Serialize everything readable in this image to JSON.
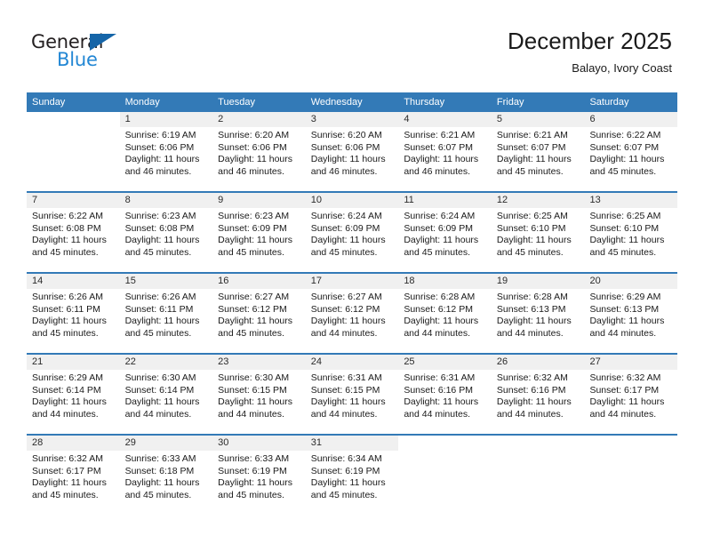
{
  "brand": {
    "name_part1": "General",
    "name_part2": "Blue",
    "triangle_color": "#1565a8",
    "blue_color": "#2387d4"
  },
  "header": {
    "title": "December 2025",
    "subtitle": "Balayo, Ivory Coast"
  },
  "theme": {
    "header_blue": "#337ab7",
    "day_band_gray": "#f0f0f0",
    "text_color": "#1a1a1a"
  },
  "weekdays": [
    "Sunday",
    "Monday",
    "Tuesday",
    "Wednesday",
    "Thursday",
    "Friday",
    "Saturday"
  ],
  "weeks": [
    [
      {
        "day": "",
        "empty": true,
        "sunrise": "",
        "sunset": "",
        "daylight_line1": "",
        "daylight_line2": ""
      },
      {
        "day": "1",
        "sunrise": "Sunrise: 6:19 AM",
        "sunset": "Sunset: 6:06 PM",
        "daylight_line1": "Daylight: 11 hours",
        "daylight_line2": "and 46 minutes."
      },
      {
        "day": "2",
        "sunrise": "Sunrise: 6:20 AM",
        "sunset": "Sunset: 6:06 PM",
        "daylight_line1": "Daylight: 11 hours",
        "daylight_line2": "and 46 minutes."
      },
      {
        "day": "3",
        "sunrise": "Sunrise: 6:20 AM",
        "sunset": "Sunset: 6:06 PM",
        "daylight_line1": "Daylight: 11 hours",
        "daylight_line2": "and 46 minutes."
      },
      {
        "day": "4",
        "sunrise": "Sunrise: 6:21 AM",
        "sunset": "Sunset: 6:07 PM",
        "daylight_line1": "Daylight: 11 hours",
        "daylight_line2": "and 46 minutes."
      },
      {
        "day": "5",
        "sunrise": "Sunrise: 6:21 AM",
        "sunset": "Sunset: 6:07 PM",
        "daylight_line1": "Daylight: 11 hours",
        "daylight_line2": "and 45 minutes."
      },
      {
        "day": "6",
        "sunrise": "Sunrise: 6:22 AM",
        "sunset": "Sunset: 6:07 PM",
        "daylight_line1": "Daylight: 11 hours",
        "daylight_line2": "and 45 minutes."
      }
    ],
    [
      {
        "day": "7",
        "sunrise": "Sunrise: 6:22 AM",
        "sunset": "Sunset: 6:08 PM",
        "daylight_line1": "Daylight: 11 hours",
        "daylight_line2": "and 45 minutes."
      },
      {
        "day": "8",
        "sunrise": "Sunrise: 6:23 AM",
        "sunset": "Sunset: 6:08 PM",
        "daylight_line1": "Daylight: 11 hours",
        "daylight_line2": "and 45 minutes."
      },
      {
        "day": "9",
        "sunrise": "Sunrise: 6:23 AM",
        "sunset": "Sunset: 6:09 PM",
        "daylight_line1": "Daylight: 11 hours",
        "daylight_line2": "and 45 minutes."
      },
      {
        "day": "10",
        "sunrise": "Sunrise: 6:24 AM",
        "sunset": "Sunset: 6:09 PM",
        "daylight_line1": "Daylight: 11 hours",
        "daylight_line2": "and 45 minutes."
      },
      {
        "day": "11",
        "sunrise": "Sunrise: 6:24 AM",
        "sunset": "Sunset: 6:09 PM",
        "daylight_line1": "Daylight: 11 hours",
        "daylight_line2": "and 45 minutes."
      },
      {
        "day": "12",
        "sunrise": "Sunrise: 6:25 AM",
        "sunset": "Sunset: 6:10 PM",
        "daylight_line1": "Daylight: 11 hours",
        "daylight_line2": "and 45 minutes."
      },
      {
        "day": "13",
        "sunrise": "Sunrise: 6:25 AM",
        "sunset": "Sunset: 6:10 PM",
        "daylight_line1": "Daylight: 11 hours",
        "daylight_line2": "and 45 minutes."
      }
    ],
    [
      {
        "day": "14",
        "sunrise": "Sunrise: 6:26 AM",
        "sunset": "Sunset: 6:11 PM",
        "daylight_line1": "Daylight: 11 hours",
        "daylight_line2": "and 45 minutes."
      },
      {
        "day": "15",
        "sunrise": "Sunrise: 6:26 AM",
        "sunset": "Sunset: 6:11 PM",
        "daylight_line1": "Daylight: 11 hours",
        "daylight_line2": "and 45 minutes."
      },
      {
        "day": "16",
        "sunrise": "Sunrise: 6:27 AM",
        "sunset": "Sunset: 6:12 PM",
        "daylight_line1": "Daylight: 11 hours",
        "daylight_line2": "and 45 minutes."
      },
      {
        "day": "17",
        "sunrise": "Sunrise: 6:27 AM",
        "sunset": "Sunset: 6:12 PM",
        "daylight_line1": "Daylight: 11 hours",
        "daylight_line2": "and 44 minutes."
      },
      {
        "day": "18",
        "sunrise": "Sunrise: 6:28 AM",
        "sunset": "Sunset: 6:12 PM",
        "daylight_line1": "Daylight: 11 hours",
        "daylight_line2": "and 44 minutes."
      },
      {
        "day": "19",
        "sunrise": "Sunrise: 6:28 AM",
        "sunset": "Sunset: 6:13 PM",
        "daylight_line1": "Daylight: 11 hours",
        "daylight_line2": "and 44 minutes."
      },
      {
        "day": "20",
        "sunrise": "Sunrise: 6:29 AM",
        "sunset": "Sunset: 6:13 PM",
        "daylight_line1": "Daylight: 11 hours",
        "daylight_line2": "and 44 minutes."
      }
    ],
    [
      {
        "day": "21",
        "sunrise": "Sunrise: 6:29 AM",
        "sunset": "Sunset: 6:14 PM",
        "daylight_line1": "Daylight: 11 hours",
        "daylight_line2": "and 44 minutes."
      },
      {
        "day": "22",
        "sunrise": "Sunrise: 6:30 AM",
        "sunset": "Sunset: 6:14 PM",
        "daylight_line1": "Daylight: 11 hours",
        "daylight_line2": "and 44 minutes."
      },
      {
        "day": "23",
        "sunrise": "Sunrise: 6:30 AM",
        "sunset": "Sunset: 6:15 PM",
        "daylight_line1": "Daylight: 11 hours",
        "daylight_line2": "and 44 minutes."
      },
      {
        "day": "24",
        "sunrise": "Sunrise: 6:31 AM",
        "sunset": "Sunset: 6:15 PM",
        "daylight_line1": "Daylight: 11 hours",
        "daylight_line2": "and 44 minutes."
      },
      {
        "day": "25",
        "sunrise": "Sunrise: 6:31 AM",
        "sunset": "Sunset: 6:16 PM",
        "daylight_line1": "Daylight: 11 hours",
        "daylight_line2": "and 44 minutes."
      },
      {
        "day": "26",
        "sunrise": "Sunrise: 6:32 AM",
        "sunset": "Sunset: 6:16 PM",
        "daylight_line1": "Daylight: 11 hours",
        "daylight_line2": "and 44 minutes."
      },
      {
        "day": "27",
        "sunrise": "Sunrise: 6:32 AM",
        "sunset": "Sunset: 6:17 PM",
        "daylight_line1": "Daylight: 11 hours",
        "daylight_line2": "and 44 minutes."
      }
    ],
    [
      {
        "day": "28",
        "sunrise": "Sunrise: 6:32 AM",
        "sunset": "Sunset: 6:17 PM",
        "daylight_line1": "Daylight: 11 hours",
        "daylight_line2": "and 45 minutes."
      },
      {
        "day": "29",
        "sunrise": "Sunrise: 6:33 AM",
        "sunset": "Sunset: 6:18 PM",
        "daylight_line1": "Daylight: 11 hours",
        "daylight_line2": "and 45 minutes."
      },
      {
        "day": "30",
        "sunrise": "Sunrise: 6:33 AM",
        "sunset": "Sunset: 6:19 PM",
        "daylight_line1": "Daylight: 11 hours",
        "daylight_line2": "and 45 minutes."
      },
      {
        "day": "31",
        "sunrise": "Sunrise: 6:34 AM",
        "sunset": "Sunset: 6:19 PM",
        "daylight_line1": "Daylight: 11 hours",
        "daylight_line2": "and 45 minutes."
      },
      {
        "day": "",
        "empty": true,
        "sunrise": "",
        "sunset": "",
        "daylight_line1": "",
        "daylight_line2": ""
      },
      {
        "day": "",
        "empty": true,
        "sunrise": "",
        "sunset": "",
        "daylight_line1": "",
        "daylight_line2": ""
      },
      {
        "day": "",
        "empty": true,
        "sunrise": "",
        "sunset": "",
        "daylight_line1": "",
        "daylight_line2": ""
      }
    ]
  ]
}
